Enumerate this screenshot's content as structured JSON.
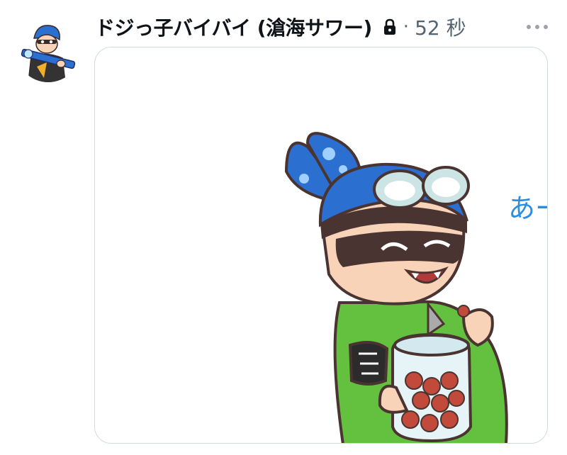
{
  "tweet": {
    "display_name": "ドジっ子バイバイ (滄海サワー)",
    "separator": "·",
    "timestamp": "52 秒",
    "protected_icon": "lock-icon",
    "more_icon": "more-horizontal-icon",
    "avatar_icon": "user-avatar",
    "media": {
      "kind": "illustration",
      "handwritten_text": "あー"
    }
  },
  "colors": {
    "name_text": "#0f1419",
    "secondary_text": "#536471",
    "media_border": "#cfd9de",
    "squid_blue": "#2b6fd1",
    "hoodie_green": "#63c13f",
    "skin": "#f8d3b8",
    "outline": "#4a3432"
  }
}
